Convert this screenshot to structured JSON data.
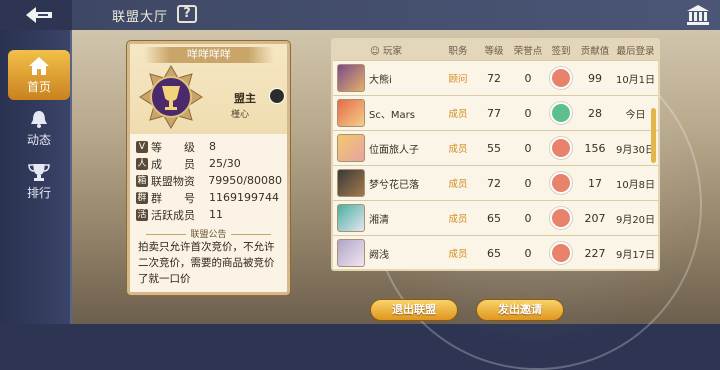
{
  "header": {
    "title": "联盟大厅",
    "help_icon": "question-icon",
    "right_icon": "bank-icon"
  },
  "sidebar": {
    "items": [
      {
        "label": "首页",
        "icon": "home-icon",
        "active": true
      },
      {
        "label": "动态",
        "icon": "bell-icon",
        "active": false
      },
      {
        "label": "排行",
        "icon": "trophy-icon",
        "active": false
      }
    ]
  },
  "guild": {
    "name": "咩咩咩咩",
    "leader_title": "盟主",
    "leader_name": "槿心",
    "stats": [
      {
        "icon": "V",
        "label": "等　　级",
        "value": "8"
      },
      {
        "icon": "人",
        "label": "成　　员",
        "value": "25/30"
      },
      {
        "icon": "箱",
        "label": "联盟物资",
        "value": "79950/80080"
      },
      {
        "icon": "群",
        "label": "群　　号",
        "value": "1169199744"
      },
      {
        "icon": "活",
        "label": "活跃成员",
        "value": "11"
      }
    ],
    "notice_title": "联盟公告",
    "notice": "拍卖只允许首次竞价，不允许二次竞价，需要的商品被竞价了就一口价"
  },
  "members": {
    "columns": [
      "玩家",
      "职务",
      "等级",
      "荣誉点",
      "签到",
      "贡献值",
      "最后登录"
    ],
    "rows": [
      {
        "name": "大熊i",
        "role": "顾问",
        "level": "72",
        "honor": "0",
        "signed": false,
        "contribution": "99",
        "last_login": "10月1日"
      },
      {
        "name": "Sc、Mars",
        "role": "成员",
        "level": "77",
        "honor": "0",
        "signed": true,
        "contribution": "28",
        "last_login": "今日"
      },
      {
        "name": "位面旅人子",
        "role": "成员",
        "level": "55",
        "honor": "0",
        "signed": false,
        "contribution": "156",
        "last_login": "9月30日"
      },
      {
        "name": "梦兮花已落",
        "role": "成员",
        "level": "72",
        "honor": "0",
        "signed": false,
        "contribution": "17",
        "last_login": "10月8日"
      },
      {
        "name": "湘清",
        "role": "成员",
        "level": "65",
        "honor": "0",
        "signed": false,
        "contribution": "207",
        "last_login": "9月20日"
      },
      {
        "name": "阙浅",
        "role": "成员",
        "level": "65",
        "honor": "0",
        "signed": false,
        "contribution": "227",
        "last_login": "9月17日"
      }
    ]
  },
  "buttons": {
    "leave": "退出联盟",
    "invite": "发出邀请"
  },
  "colors": {
    "accent": "#e0961e",
    "sign_done": "#5cc08c",
    "sign_pending": "#e8826a"
  }
}
